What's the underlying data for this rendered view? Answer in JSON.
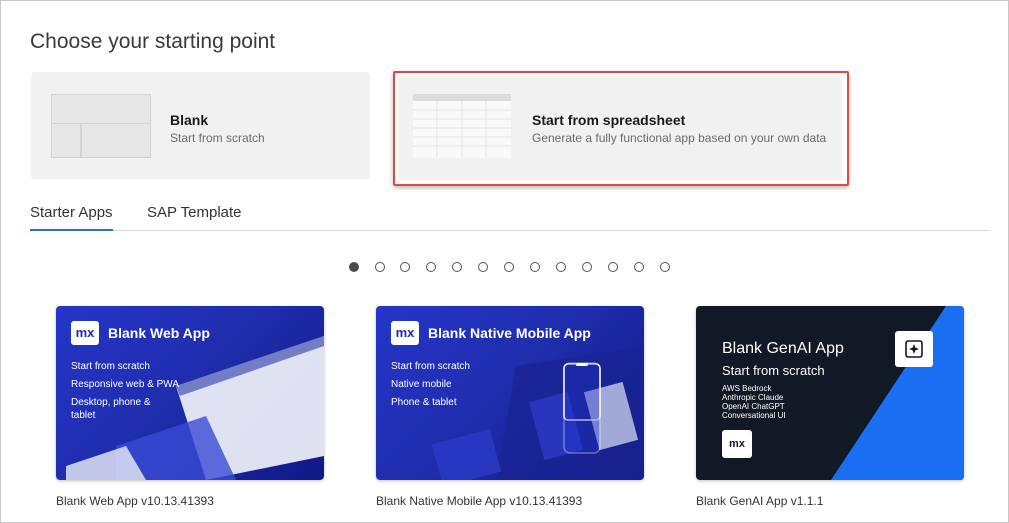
{
  "page": {
    "title": "Choose your starting point"
  },
  "options": {
    "blank": {
      "title": "Blank",
      "description": "Start from scratch"
    },
    "spreadsheet": {
      "title": "Start from spreadsheet",
      "description": "Generate a fully functional app based on your own data"
    }
  },
  "tabs": [
    {
      "label": "Starter Apps",
      "active": true
    },
    {
      "label": "SAP Template",
      "active": false
    }
  ],
  "carousel": {
    "page_count": 13,
    "active_index": 0
  },
  "cards": [
    {
      "badge": "mx",
      "heading": "Blank Web App",
      "lines": [
        "Start from scratch",
        "Responsive web & PWA",
        "Desktop, phone &",
        "tablet"
      ],
      "caption": "Blank Web App v10.13.41393"
    },
    {
      "badge": "mx",
      "heading": "Blank Native Mobile App",
      "lines": [
        "Start from scratch",
        "Native mobile",
        "Phone & tablet"
      ],
      "caption": "Blank Native Mobile App v10.13.41393"
    },
    {
      "badge": "mx",
      "heading": "Blank GenAI App",
      "subheading": "Start from scratch",
      "lines": [
        "AWS Bedrock",
        "Anthropic Claude",
        "OpenAI ChatGPT",
        "Conversational UI"
      ],
      "caption": "Blank GenAI App v1.1.1"
    }
  ],
  "colors": {
    "highlight": "#e04848",
    "tab_underline": "#2f6fcc",
    "card_blue": "#1f2eae",
    "genai_accent": "#1a6ef2"
  }
}
